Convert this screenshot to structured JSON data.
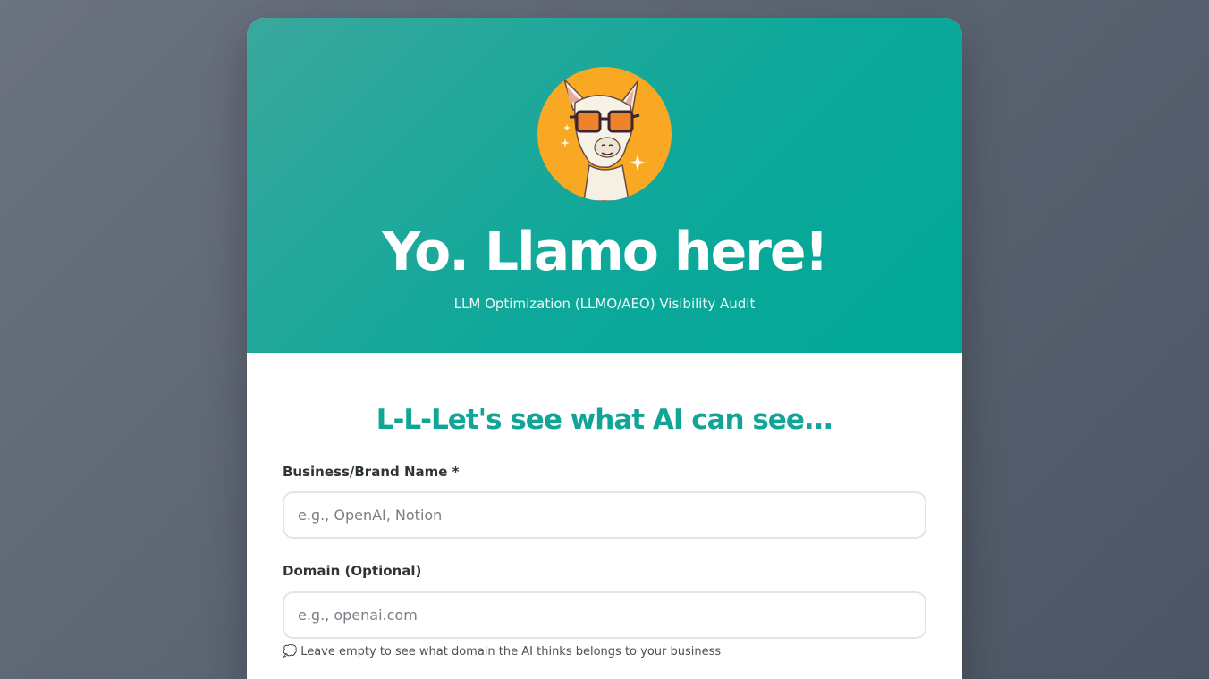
{
  "header": {
    "title": "Yo. Llamo here!",
    "subtitle": "LLM Optimization (LLMO/AEO) Visibility Audit",
    "avatar_icon": "llama-with-sunglasses-icon",
    "colors": {
      "gradient_start": "#3aa79c",
      "gradient_end": "#00a898",
      "avatar_bg": "#f8a823"
    }
  },
  "form": {
    "heading": "L-L-Let's see what AI can see...",
    "business_name": {
      "label": "Business/Brand Name *",
      "placeholder": "e.g., OpenAI, Notion",
      "value": ""
    },
    "domain": {
      "label": "Domain (Optional)",
      "placeholder": "e.g., openai.com",
      "value": "",
      "hint": "Leave empty to see what domain the AI thinks belongs to your business",
      "hint_icon": "thought-bubble-icon"
    }
  }
}
